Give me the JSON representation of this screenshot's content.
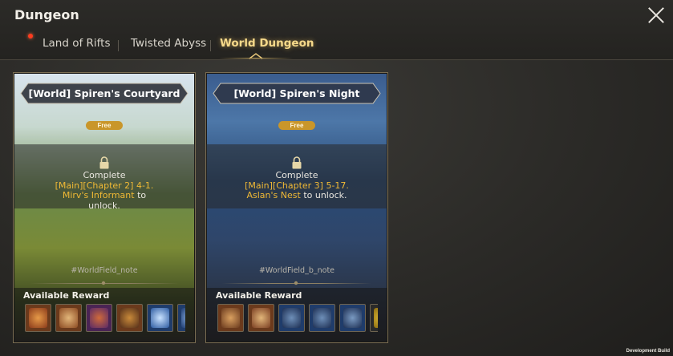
{
  "header": {
    "title": "Dungeon"
  },
  "tabs": [
    {
      "label": "Land of Rifts",
      "active": false,
      "has_alert": true
    },
    {
      "label": "Twisted Abyss",
      "active": false
    },
    {
      "label": "World Dungeon",
      "active": true
    }
  ],
  "cards": [
    {
      "name": "[World] Spiren's Courtyard",
      "badge": "Free",
      "lock_prefix": "Complete",
      "requirement_line1": "[Main][Chapter 2] 4-1.",
      "requirement_line2": "Mirv's Informant",
      "lock_suffix": "to",
      "lock_end": "unlock.",
      "note": "#WorldField_note",
      "rewards_label": "Available Reward",
      "rewards": [
        "orange-card-reward",
        "orange-card-reward",
        "purple-card-reward",
        "orange-card-reward",
        "blue-trophy-reward",
        "blue-partial-reward"
      ]
    },
    {
      "name": "[World] Spiren's Night",
      "badge": "Free",
      "lock_prefix": "Complete",
      "requirement_line1": "[Main][Chapter 3] 5-17.",
      "requirement_line2": "Aslan's Nest",
      "lock_suffix": "to unlock.",
      "note": "#WorldField_b_note",
      "rewards_label": "Available Reward",
      "rewards": [
        "orange-card-reward",
        "orange-card-reward",
        "blue-statue-reward",
        "blue-statue-reward",
        "blue-statue-reward",
        "gold-partial-reward"
      ]
    }
  ],
  "footer": {
    "build_label": "Development Build"
  },
  "colors": {
    "accent_gold": "#f0b935",
    "active_tab": "#f5d98a",
    "alert": "#ff3b1f",
    "free_badge": "#c9962a"
  }
}
